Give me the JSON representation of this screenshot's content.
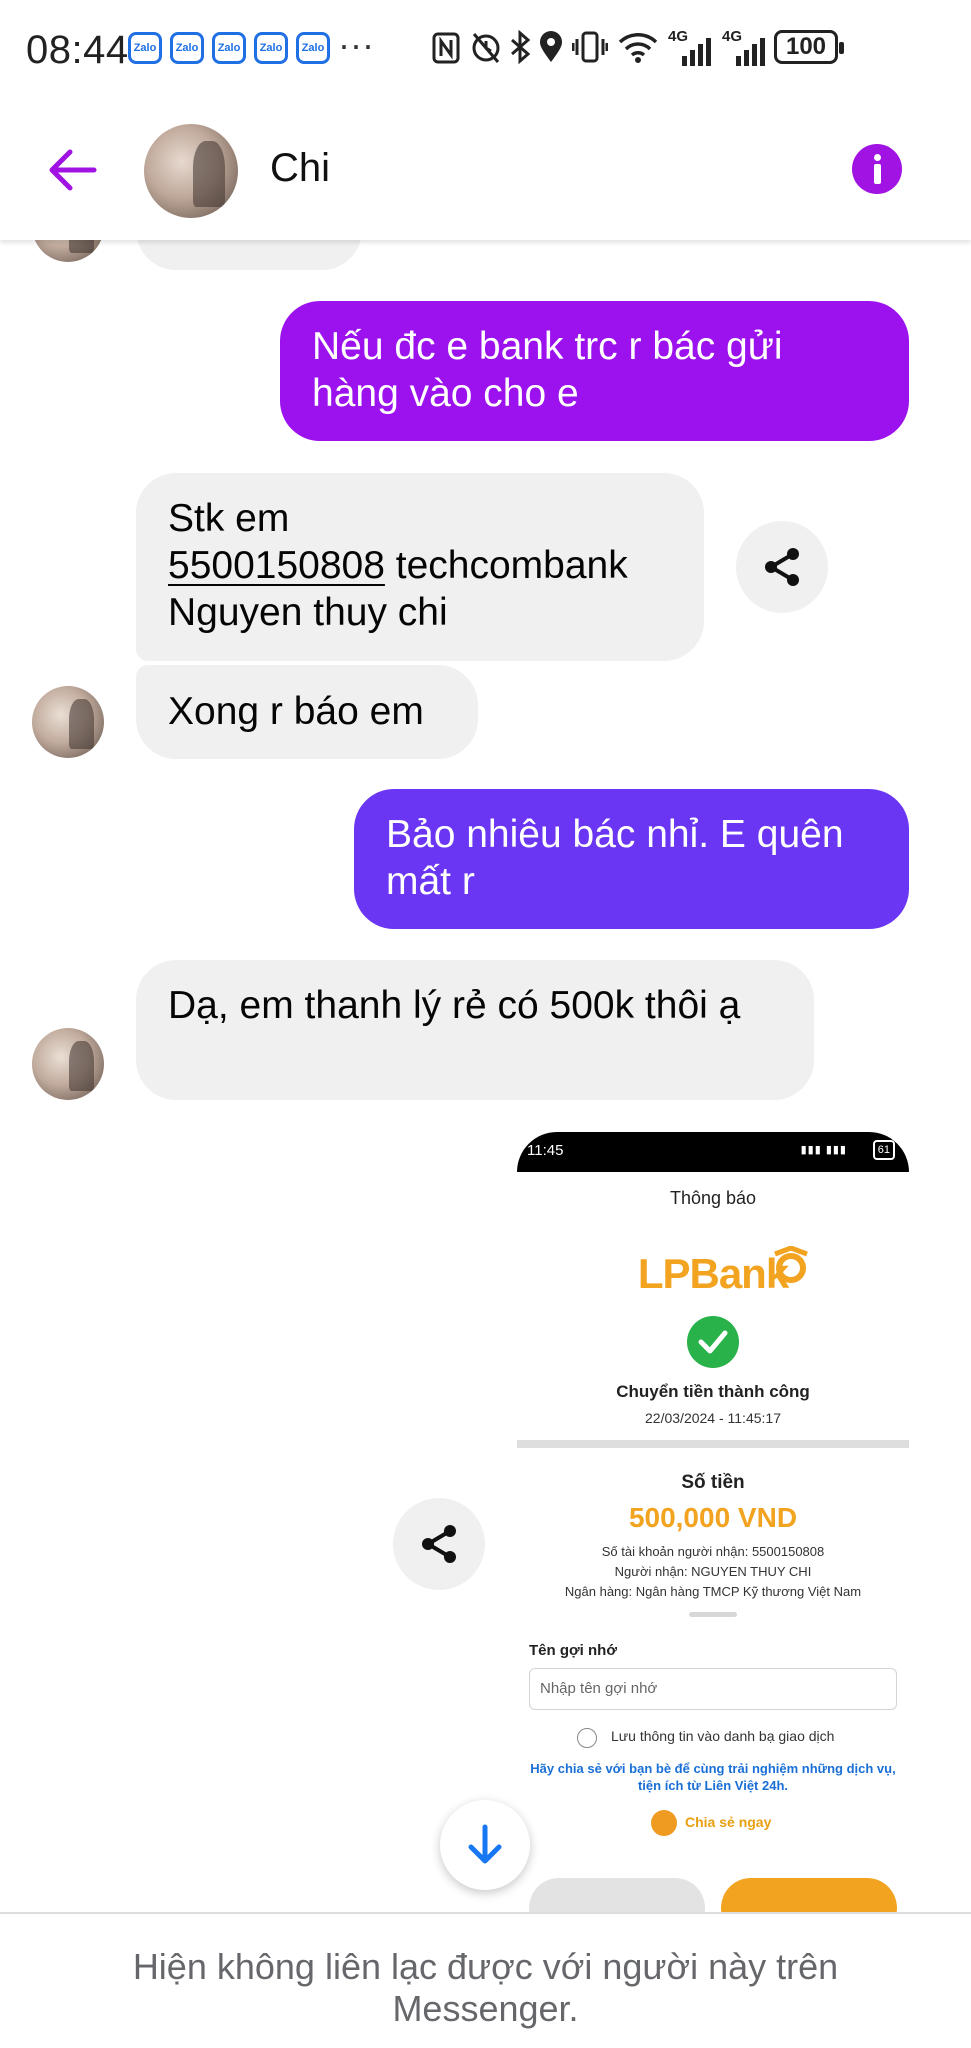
{
  "status_bar": {
    "time": "08:44",
    "notification_icons": [
      "Zalo",
      "Zalo",
      "Zalo",
      "Zalo",
      "Zalo"
    ],
    "overflow": "···",
    "network_1": "4G",
    "network_2": "4G",
    "battery": "100"
  },
  "header": {
    "contact_name": "Chi",
    "back_icon": "arrow-left-icon",
    "info_icon": "info-icon",
    "accent_color": "#a013e3"
  },
  "messages": [
    {
      "from": "me",
      "text": "Nếu đc e bank trc r bác gửi hàng vào cho e",
      "color": "#9b12ee"
    },
    {
      "from": "them",
      "lines": [
        "Stk em",
        "5500150808",
        "techcombank",
        "Nguyen thuy chi"
      ]
    },
    {
      "from": "them",
      "text": "Xong r báo em"
    },
    {
      "from": "me",
      "text": "Bảo nhiêu bác nhỉ. E quên mất r",
      "color": "#6a36f3"
    },
    {
      "from": "them",
      "text": "Dạ, em thanh lý rẻ có 500k thôi ạ"
    }
  ],
  "screenshot": {
    "time": "11:45",
    "battery": "61",
    "title": "Thông báo",
    "bank_logo": "LPBank",
    "success": "Chuyển tiền thành công",
    "datetime": "22/03/2024 - 11:45:17",
    "amount_label": "Số tiền",
    "amount": "500,000 VND",
    "account": "Số tài khoản người nhận: 5500150808",
    "recipient": "Người nhận: NGUYEN THUY CHI",
    "bank": "Ngân hàng: Ngân hàng TMCP Kỹ thương Việt Nam",
    "alias_label": "Tên gợi nhớ",
    "alias_placeholder": "Nhập tên gợi nhớ",
    "save_contact": "Lưu thông tin vào danh bạ giao dịch",
    "promo": "Hãy chia sẻ với bạn bè để cùng trải nghiệm những dịch vụ, tiện ích từ Liên Việt 24h.",
    "share_now": "Chia sẻ ngay"
  },
  "footer": {
    "text": "Hiện không liên lạc được với người này trên Messenger."
  }
}
